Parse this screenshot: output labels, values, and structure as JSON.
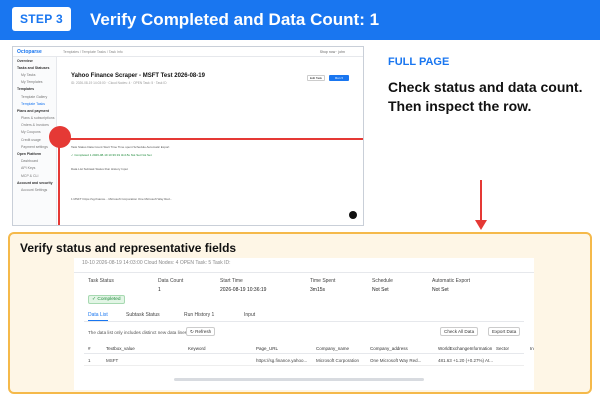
{
  "banner": {
    "step": "STEP 3",
    "title": "Verify Completed and Data Count: 1"
  },
  "side": {
    "full_page": "FULL PAGE",
    "instruction_1": "Check status and data count.",
    "instruction_2": "Then inspect the row."
  },
  "thumb": {
    "logo": "Octoparse",
    "breadcrumb": "Templates / Template Tasks / Task Info",
    "user": "Shop now  ·  john",
    "title": "Yahoo Finance Scraper - MSFT Test 2026-08-19",
    "meta": "ID: 2026-08-19 14:03:00  ·  Cloud Nodes: 4  ·  OPEN Task: 5  ·  Task ID",
    "btn_edit": "Edit Task",
    "btn_run": "Run ▾",
    "sidebar": [
      {
        "label": "Overview",
        "kind": "grp"
      },
      {
        "label": "Tasks and Statuses",
        "kind": "grp"
      },
      {
        "label": "My Tasks",
        "kind": "sub"
      },
      {
        "label": "My Templates",
        "kind": "sub"
      },
      {
        "label": "Templates",
        "kind": "grp"
      },
      {
        "label": "Template Gallery",
        "kind": "sub"
      },
      {
        "label": "Template Tasks",
        "kind": "sub act"
      },
      {
        "label": "Plans and payment",
        "kind": "grp"
      },
      {
        "label": "Plans & subscriptions",
        "kind": "sub"
      },
      {
        "label": "Orders & Invoices",
        "kind": "sub"
      },
      {
        "label": "My Coupons",
        "kind": "sub"
      },
      {
        "label": "Credit usage",
        "kind": "sub"
      },
      {
        "label": "Payment settings",
        "kind": "sub"
      },
      {
        "label": "Open Platform",
        "kind": "grp"
      },
      {
        "label": "Dashboard",
        "kind": "sub"
      },
      {
        "label": "API Keys",
        "kind": "sub"
      },
      {
        "label": "MCP & CLI",
        "kind": "sub"
      },
      {
        "label": "Account and security",
        "kind": "grp"
      },
      {
        "label": "Account Settings",
        "kind": "sub"
      }
    ],
    "stat_row": "Task Status   Data Count   Start Time   Time spent   Schedule   Automatic Export",
    "val_row": "✓ Completed    1    2026-08-19 10:36:19    3m15s    Not Set    Not Set",
    "tabs_row": "Data List   Subtask Status   Run History   Input",
    "row_line": "1    MSFT    https://sg.finance...    Microsoft Corporation    One Microsoft Way Red..."
  },
  "zoom": {
    "title": "Verify status and representative fields",
    "cut_text": "10-10   2026-08-19   14:03:00        Cloud Nodes: 4        OPEN Task: 5        Task ID:",
    "stats": [
      {
        "label": "Task Status",
        "value": "✓ Completed"
      },
      {
        "label": "Data Count",
        "value": "1"
      },
      {
        "label": "Start Time",
        "value": "2026-08-19 10:36:19"
      },
      {
        "label": "Time Spent",
        "value": "3m15s"
      },
      {
        "label": "Schedule",
        "value": "Not Set"
      },
      {
        "label": "Automatic Export",
        "value": "Not Set"
      }
    ],
    "tabs": [
      "Data List",
      "Subtask Status",
      "Run History  1",
      "Input"
    ],
    "note": "The data list only includes distinct new data lines",
    "refresh": "↻ Refresh",
    "check_all": "Check All Data",
    "export": "Export Data",
    "columns": [
      "#",
      "Textbox_value",
      "Keyword",
      "Page_URL",
      "Company_name",
      "Company_address",
      "WorldExchangeInformation",
      "Sector",
      "Industry"
    ],
    "row": [
      "1",
      "MSFT",
      "",
      "https://sg.finance.yahoo...",
      "Microsoft Corporation",
      "One Microsoft Way Red...",
      "481.63 +1.20 (+0.27%) At...",
      "",
      ""
    ]
  }
}
